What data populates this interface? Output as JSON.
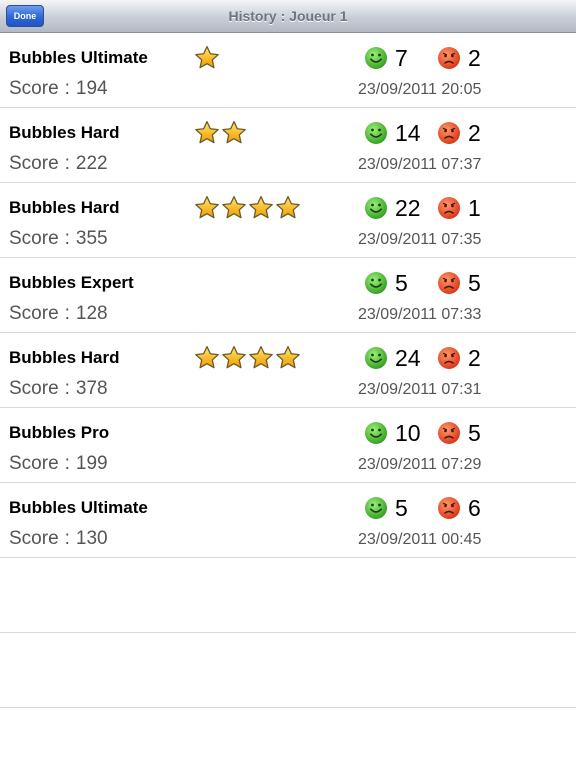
{
  "navbar": {
    "done_label": "Done",
    "title": "History : Joueur 1"
  },
  "score_label": "Score",
  "score_separator": ":",
  "icons": {
    "star": "star-icon",
    "happy": "smiley-happy-icon",
    "sad": "smiley-sad-icon",
    "colors": {
      "happy": "#3fb52a",
      "sad": "#e8411a",
      "star": "#f5a800"
    }
  },
  "rows": [
    {
      "game": "Bubbles  Ultimate",
      "score": "194",
      "stars": 1,
      "wins": "7",
      "losses": "2",
      "date": "23/09/2011  20:05"
    },
    {
      "game": "Bubbles  Hard",
      "score": "222",
      "stars": 2,
      "wins": "14",
      "losses": "2",
      "date": "23/09/2011  07:37"
    },
    {
      "game": "Bubbles  Hard",
      "score": "355",
      "stars": 4,
      "wins": "22",
      "losses": "1",
      "date": "23/09/2011  07:35"
    },
    {
      "game": "Bubbles  Expert",
      "score": "128",
      "stars": 0,
      "wins": "5",
      "losses": "5",
      "date": "23/09/2011  07:33"
    },
    {
      "game": "Bubbles  Hard",
      "score": "378",
      "stars": 4,
      "wins": "24",
      "losses": "2",
      "date": "23/09/2011  07:31"
    },
    {
      "game": "Bubbles  Pro",
      "score": "199",
      "stars": 0,
      "wins": "10",
      "losses": "5",
      "date": "23/09/2011  07:29"
    },
    {
      "game": "Bubbles  Ultimate",
      "score": "130",
      "stars": 0,
      "wins": "5",
      "losses": "6",
      "date": "23/09/2011  00:45"
    }
  ]
}
